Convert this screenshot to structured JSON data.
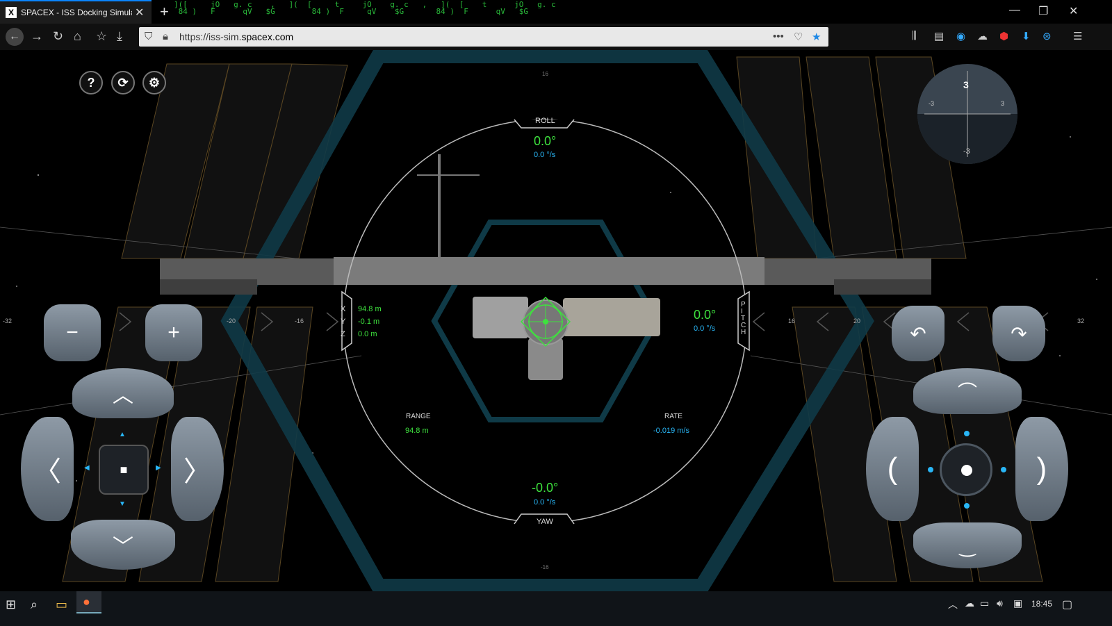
{
  "browser": {
    "tab_title": "SPACEX - ISS Docking Simulator",
    "tab_favicon": "X",
    "url_prefix": "https://iss-sim.",
    "url_domain": "spacex.com",
    "new_tab_icon": "plus-icon",
    "menu_icon": "hamburger-icon"
  },
  "hud": {
    "roll_label": "ROLL",
    "roll_value": "0.0°",
    "roll_rate": "0.0 °/s",
    "yaw_label": "YAW",
    "yaw_value": "-0.0°",
    "yaw_rate": "0.0 °/s",
    "pitch_label": "PITCH",
    "pitch_value": "0.0°",
    "pitch_rate": "0.0 °/s",
    "x_label": "X",
    "x_value": "94.8 m",
    "y_label": "Y",
    "y_value": "-0.1 m",
    "z_label": "Z",
    "z_value": "0.0 m",
    "range_label": "RANGE",
    "range_value": "94.8 m",
    "rate_label": "RATE",
    "rate_value": "-0.019 m/s",
    "scale_left_outer": "-32",
    "scale_left_mid": "-20",
    "scale_left_inner": "-16",
    "scale_right_inner": "16",
    "scale_right_mid": "20",
    "scale_right_outer": "32",
    "scale_top": "16",
    "scale_bottom": "-16"
  },
  "controls": {
    "help_label": "?",
    "minus_label": "−",
    "plus_label": "+",
    "stop_label": "■"
  },
  "attitude_ball": {
    "top": "3",
    "left": "-3",
    "right": "3",
    "bottom": "-3"
  },
  "taskbar": {
    "time": "18:45"
  },
  "colors": {
    "accent_green": "#3ee23e",
    "accent_blue": "#29b6f6",
    "hex_outline": "#0f3a47"
  }
}
